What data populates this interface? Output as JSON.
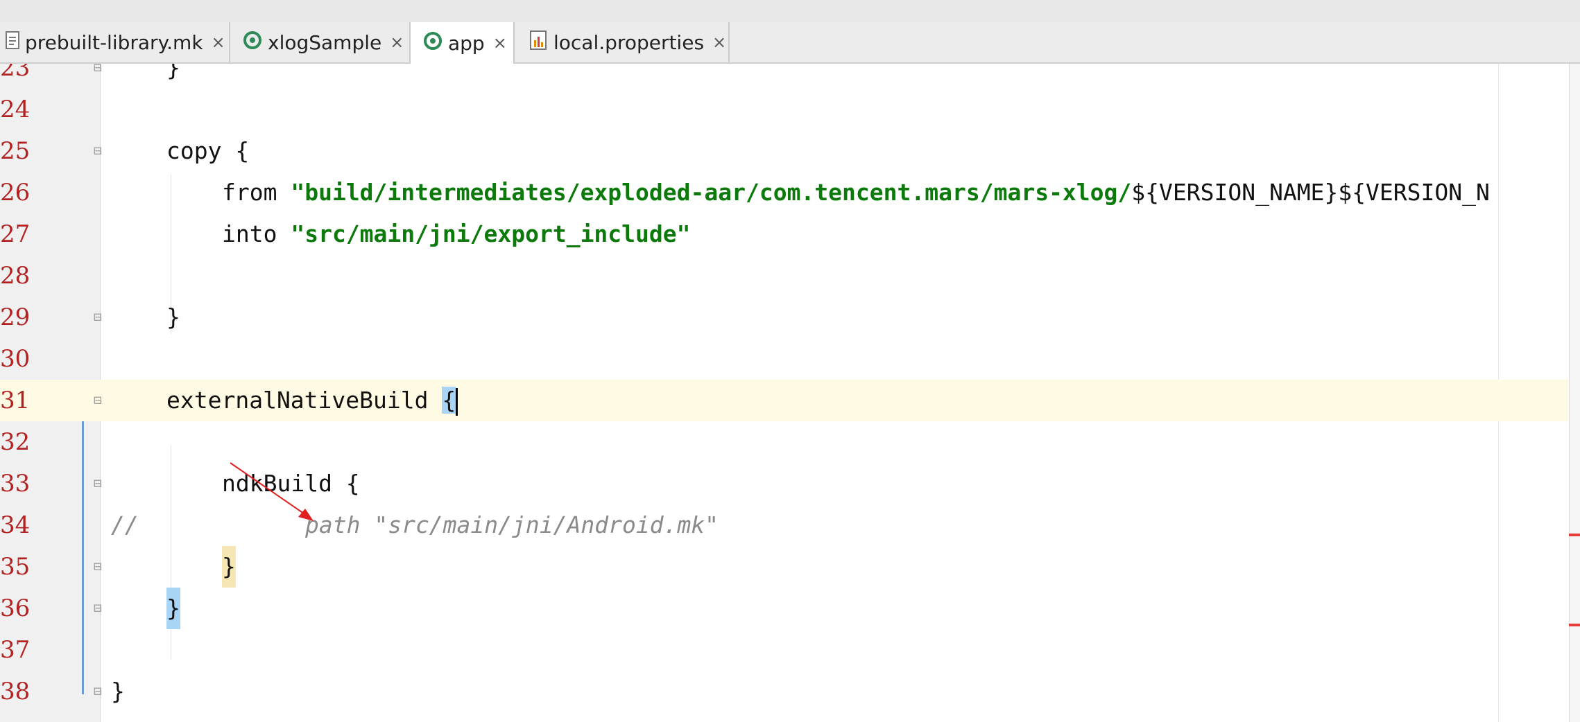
{
  "tabs": [
    {
      "label": "prebuilt-library.mk",
      "icon": "file-icon",
      "active": false
    },
    {
      "label": "xlogSample",
      "icon": "module-icon",
      "active": false
    },
    {
      "label": "app",
      "icon": "module-icon",
      "active": true
    },
    {
      "label": "local.properties",
      "icon": "properties-icon",
      "active": false
    }
  ],
  "close_glyph": "×",
  "lines": {
    "l23": {
      "num": "23",
      "code": "}"
    },
    "l24": {
      "num": "24",
      "code": ""
    },
    "l25": {
      "num": "25",
      "code": "copy {"
    },
    "l26": {
      "num": "26",
      "keyword": "from ",
      "string": "\"build/intermediates/exploded-aar/com.tencent.mars/mars-xlog/",
      "tail": "${VERSION_NAME}${VERSION_N"
    },
    "l27": {
      "num": "27",
      "keyword": "into ",
      "string": "\"src/main/jni/export_include\""
    },
    "l28": {
      "num": "28",
      "code": ""
    },
    "l29": {
      "num": "29",
      "code": "}"
    },
    "l30": {
      "num": "30",
      "code": ""
    },
    "l31": {
      "num": "31",
      "code": "externalNativeBuild ",
      "brace": "{"
    },
    "l32": {
      "num": "32",
      "code": ""
    },
    "l33": {
      "num": "33",
      "code": "ndkBuild {"
    },
    "l34": {
      "num": "34",
      "comment_prefix": "//",
      "comment": "path \"src/main/jni/Android.mk\""
    },
    "l35": {
      "num": "35",
      "brace": "}"
    },
    "l36": {
      "num": "36",
      "brace": "}"
    },
    "l37": {
      "num": "37",
      "code": ""
    },
    "l38": {
      "num": "38",
      "code": "}"
    }
  },
  "colors": {
    "line_number": "#b22222",
    "string": "#0b7a0b",
    "comment": "#8a8a8a",
    "current_line": "#fffae3",
    "brace_match": "#a8d4f5",
    "annotation_arrow": "#e02020"
  }
}
